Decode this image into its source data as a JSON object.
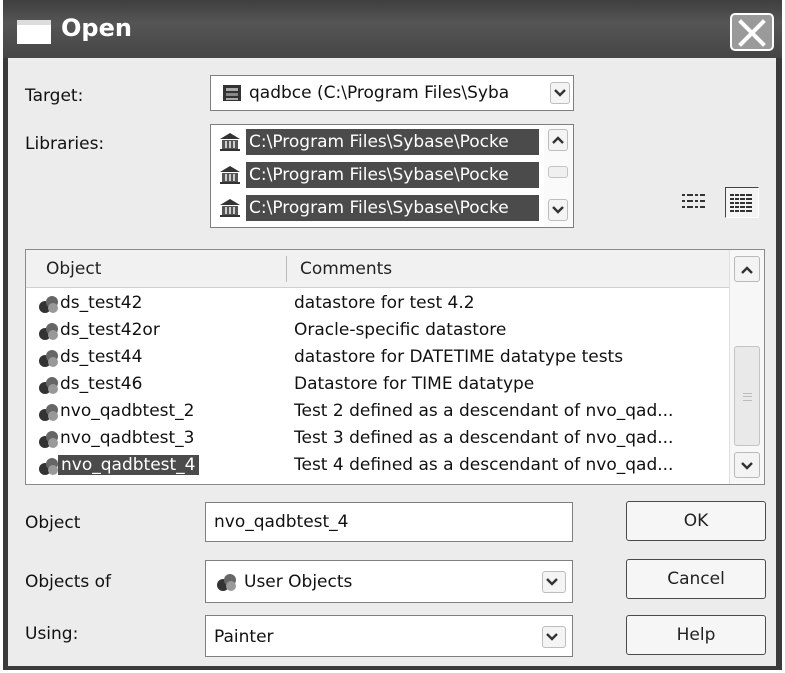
{
  "window": {
    "title": "Open"
  },
  "target": {
    "label": "Target:",
    "value": "qadbce (C:\\Program Files\\Syba",
    "icon": "database-icon"
  },
  "libraries": {
    "label": "Libraries:",
    "items": [
      "C:\\Program Files\\Sybase\\Pocke",
      "C:\\Program Files\\Sybase\\Pocke",
      "C:\\Program Files\\Sybase\\Pocke"
    ],
    "icon": "library-icon"
  },
  "view_buttons": [
    "list-view-icon",
    "details-view-icon"
  ],
  "object_list": {
    "columns": [
      "Object",
      "Comments"
    ],
    "rows": [
      {
        "name": "ds_test42",
        "comment": "datastore for test 4.2"
      },
      {
        "name": "ds_test42or",
        "comment": "Oracle-specific datastore"
      },
      {
        "name": "ds_test44",
        "comment": "datastore for DATETIME datatype tests"
      },
      {
        "name": "ds_test46",
        "comment": "Datastore for TIME datatype"
      },
      {
        "name": "nvo_qadbtest_2",
        "comment": "Test 2 defined as a descendant of nvo_qad..."
      },
      {
        "name": "nvo_qadbtest_3",
        "comment": "Test 3 defined as a descendant of nvo_qad..."
      },
      {
        "name": "nvo_qadbtest_4",
        "comment": "Test 4 defined as a descendant of nvo_qad..."
      }
    ],
    "selected_index": 6
  },
  "object_field": {
    "label": "Object",
    "value": "nvo_qadbtest_4"
  },
  "objects_of": {
    "label": "Objects of",
    "value": "User Objects"
  },
  "using": {
    "label": "Using:",
    "value": "Painter"
  },
  "buttons": {
    "ok": "OK",
    "cancel": "Cancel",
    "help": "Help"
  }
}
